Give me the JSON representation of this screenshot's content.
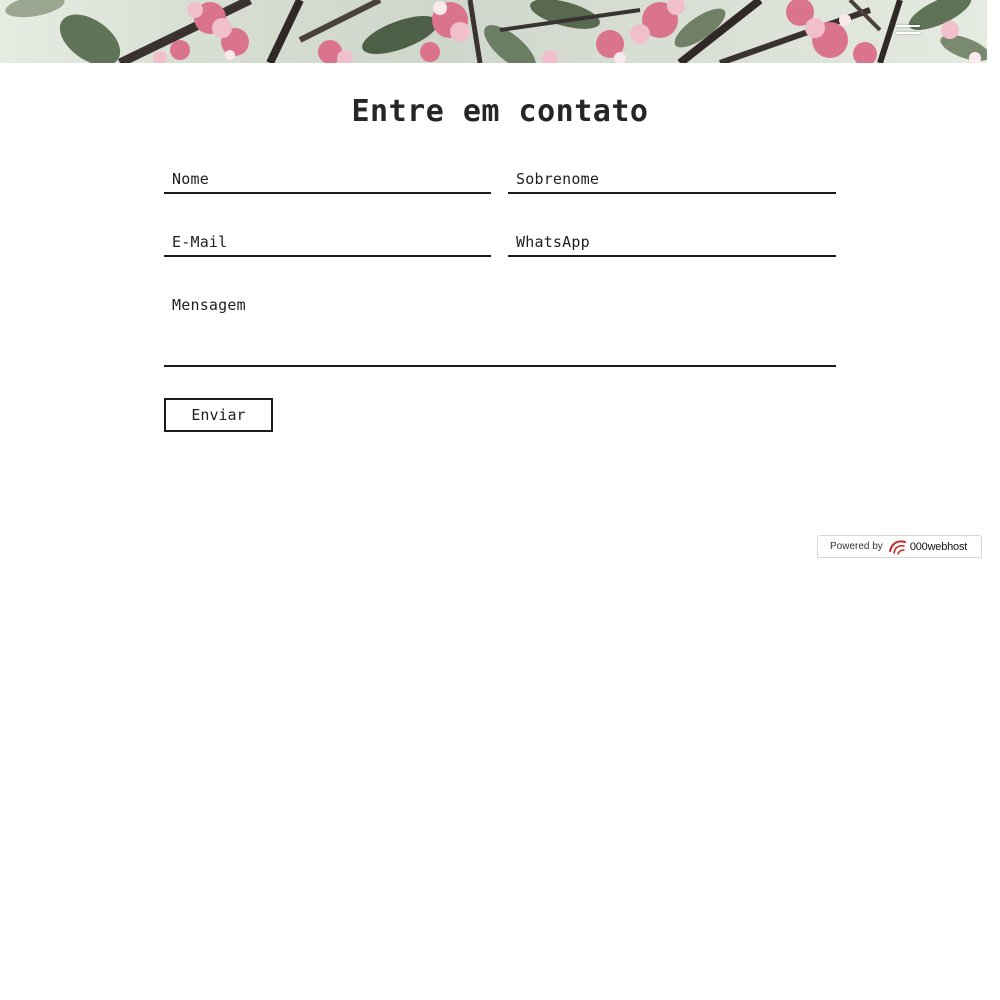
{
  "header": {
    "banner_image": "cherry-blossom-branches",
    "menu_icon": "hamburger-menu-icon"
  },
  "contact": {
    "title": "Entre em contato",
    "fields": {
      "first_name": "Nome",
      "last_name": "Sobrenome",
      "email": "E-Mail",
      "whatsapp": "WhatsApp",
      "message": "Mensagem"
    },
    "submit_label": "Enviar"
  },
  "badge": {
    "powered_by": "Powered by",
    "host_name": "000webhost",
    "logo_icon": "000webhost-logo-icon"
  },
  "colors": {
    "text": "#1f1f1f",
    "line": "#1c1c1c",
    "background": "#ffffff",
    "logo_red": "#c62828"
  }
}
